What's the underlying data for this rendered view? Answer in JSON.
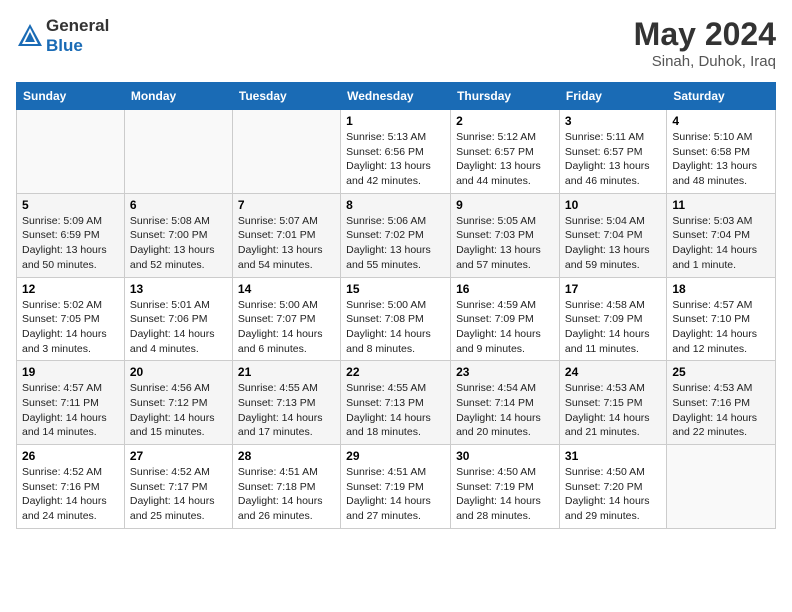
{
  "header": {
    "logo_general": "General",
    "logo_blue": "Blue",
    "month_year": "May 2024",
    "location": "Sinah, Duhok, Iraq"
  },
  "days_of_week": [
    "Sunday",
    "Monday",
    "Tuesday",
    "Wednesday",
    "Thursday",
    "Friday",
    "Saturday"
  ],
  "weeks": [
    [
      {
        "day": "",
        "info": ""
      },
      {
        "day": "",
        "info": ""
      },
      {
        "day": "",
        "info": ""
      },
      {
        "day": "1",
        "info": "Sunrise: 5:13 AM\nSunset: 6:56 PM\nDaylight: 13 hours\nand 42 minutes."
      },
      {
        "day": "2",
        "info": "Sunrise: 5:12 AM\nSunset: 6:57 PM\nDaylight: 13 hours\nand 44 minutes."
      },
      {
        "day": "3",
        "info": "Sunrise: 5:11 AM\nSunset: 6:57 PM\nDaylight: 13 hours\nand 46 minutes."
      },
      {
        "day": "4",
        "info": "Sunrise: 5:10 AM\nSunset: 6:58 PM\nDaylight: 13 hours\nand 48 minutes."
      }
    ],
    [
      {
        "day": "5",
        "info": "Sunrise: 5:09 AM\nSunset: 6:59 PM\nDaylight: 13 hours\nand 50 minutes."
      },
      {
        "day": "6",
        "info": "Sunrise: 5:08 AM\nSunset: 7:00 PM\nDaylight: 13 hours\nand 52 minutes."
      },
      {
        "day": "7",
        "info": "Sunrise: 5:07 AM\nSunset: 7:01 PM\nDaylight: 13 hours\nand 54 minutes."
      },
      {
        "day": "8",
        "info": "Sunrise: 5:06 AM\nSunset: 7:02 PM\nDaylight: 13 hours\nand 55 minutes."
      },
      {
        "day": "9",
        "info": "Sunrise: 5:05 AM\nSunset: 7:03 PM\nDaylight: 13 hours\nand 57 minutes."
      },
      {
        "day": "10",
        "info": "Sunrise: 5:04 AM\nSunset: 7:04 PM\nDaylight: 13 hours\nand 59 minutes."
      },
      {
        "day": "11",
        "info": "Sunrise: 5:03 AM\nSunset: 7:04 PM\nDaylight: 14 hours\nand 1 minute."
      }
    ],
    [
      {
        "day": "12",
        "info": "Sunrise: 5:02 AM\nSunset: 7:05 PM\nDaylight: 14 hours\nand 3 minutes."
      },
      {
        "day": "13",
        "info": "Sunrise: 5:01 AM\nSunset: 7:06 PM\nDaylight: 14 hours\nand 4 minutes."
      },
      {
        "day": "14",
        "info": "Sunrise: 5:00 AM\nSunset: 7:07 PM\nDaylight: 14 hours\nand 6 minutes."
      },
      {
        "day": "15",
        "info": "Sunrise: 5:00 AM\nSunset: 7:08 PM\nDaylight: 14 hours\nand 8 minutes."
      },
      {
        "day": "16",
        "info": "Sunrise: 4:59 AM\nSunset: 7:09 PM\nDaylight: 14 hours\nand 9 minutes."
      },
      {
        "day": "17",
        "info": "Sunrise: 4:58 AM\nSunset: 7:09 PM\nDaylight: 14 hours\nand 11 minutes."
      },
      {
        "day": "18",
        "info": "Sunrise: 4:57 AM\nSunset: 7:10 PM\nDaylight: 14 hours\nand 12 minutes."
      }
    ],
    [
      {
        "day": "19",
        "info": "Sunrise: 4:57 AM\nSunset: 7:11 PM\nDaylight: 14 hours\nand 14 minutes."
      },
      {
        "day": "20",
        "info": "Sunrise: 4:56 AM\nSunset: 7:12 PM\nDaylight: 14 hours\nand 15 minutes."
      },
      {
        "day": "21",
        "info": "Sunrise: 4:55 AM\nSunset: 7:13 PM\nDaylight: 14 hours\nand 17 minutes."
      },
      {
        "day": "22",
        "info": "Sunrise: 4:55 AM\nSunset: 7:13 PM\nDaylight: 14 hours\nand 18 minutes."
      },
      {
        "day": "23",
        "info": "Sunrise: 4:54 AM\nSunset: 7:14 PM\nDaylight: 14 hours\nand 20 minutes."
      },
      {
        "day": "24",
        "info": "Sunrise: 4:53 AM\nSunset: 7:15 PM\nDaylight: 14 hours\nand 21 minutes."
      },
      {
        "day": "25",
        "info": "Sunrise: 4:53 AM\nSunset: 7:16 PM\nDaylight: 14 hours\nand 22 minutes."
      }
    ],
    [
      {
        "day": "26",
        "info": "Sunrise: 4:52 AM\nSunset: 7:16 PM\nDaylight: 14 hours\nand 24 minutes."
      },
      {
        "day": "27",
        "info": "Sunrise: 4:52 AM\nSunset: 7:17 PM\nDaylight: 14 hours\nand 25 minutes."
      },
      {
        "day": "28",
        "info": "Sunrise: 4:51 AM\nSunset: 7:18 PM\nDaylight: 14 hours\nand 26 minutes."
      },
      {
        "day": "29",
        "info": "Sunrise: 4:51 AM\nSunset: 7:19 PM\nDaylight: 14 hours\nand 27 minutes."
      },
      {
        "day": "30",
        "info": "Sunrise: 4:50 AM\nSunset: 7:19 PM\nDaylight: 14 hours\nand 28 minutes."
      },
      {
        "day": "31",
        "info": "Sunrise: 4:50 AM\nSunset: 7:20 PM\nDaylight: 14 hours\nand 29 minutes."
      },
      {
        "day": "",
        "info": ""
      }
    ]
  ]
}
